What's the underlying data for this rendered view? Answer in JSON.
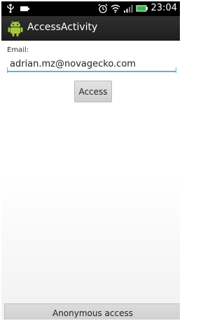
{
  "status_bar": {
    "time": "23:04",
    "icons_left": [
      "usb-icon",
      "battery-notification-icon"
    ],
    "icons_right": [
      "alarm-clock-icon",
      "wifi-icon",
      "signal-icon",
      "battery-icon"
    ],
    "battery_color": "#39b54a"
  },
  "action_bar": {
    "title": "AccessActivity",
    "icon": "android-icon"
  },
  "form": {
    "email_label": "Email:",
    "email_value": "adrian.mz@novagecko.com",
    "access_button_label": "Access"
  },
  "footer": {
    "anonymous_button_label": "Anonymous access"
  },
  "colors": {
    "accent": "#5fb4d8",
    "android_green": "#a4c639"
  }
}
